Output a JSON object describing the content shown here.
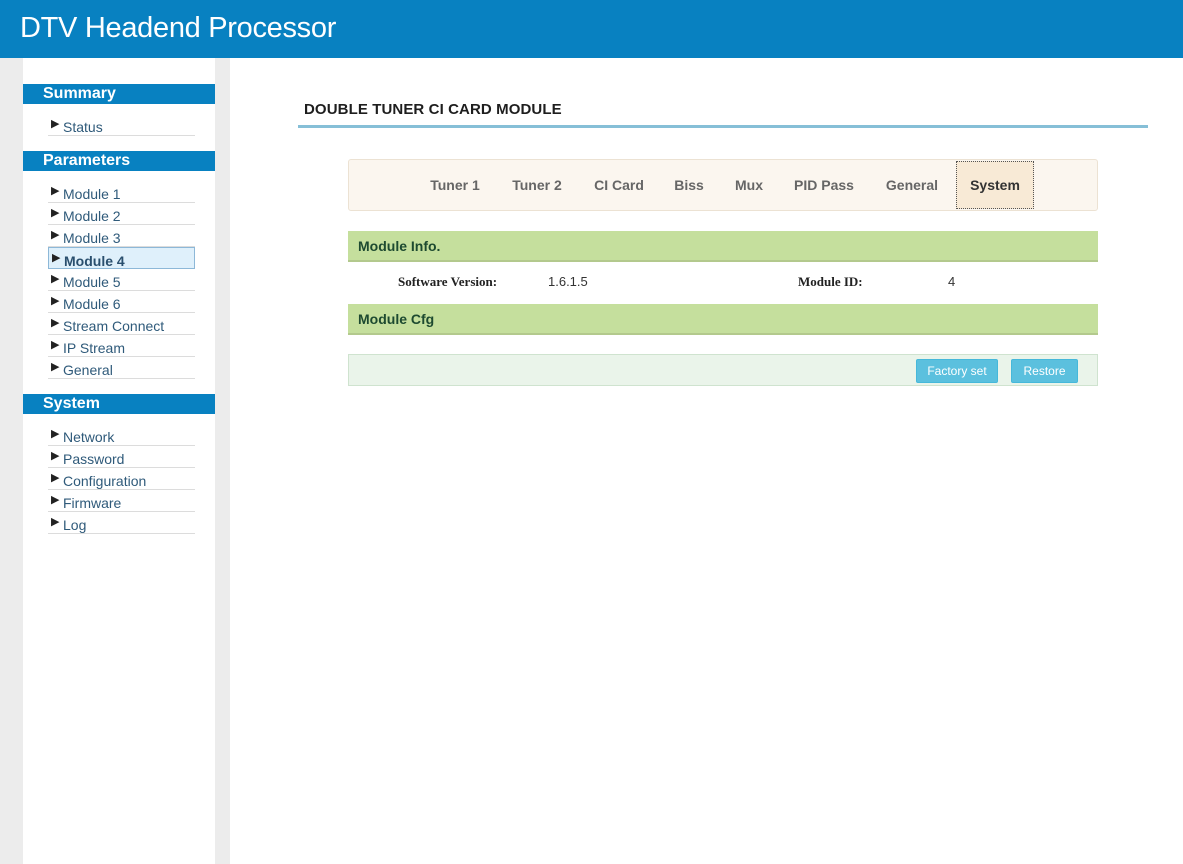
{
  "app": {
    "title": "DTV Headend Processor"
  },
  "sidebar": {
    "sections": [
      {
        "heading": "Summary",
        "items": [
          {
            "label": "Status"
          }
        ]
      },
      {
        "heading": "Parameters",
        "items": [
          {
            "label": "Module 1"
          },
          {
            "label": "Module 2"
          },
          {
            "label": "Module 3"
          },
          {
            "label": "Module 4",
            "active": true
          },
          {
            "label": "Module 5"
          },
          {
            "label": "Module 6"
          },
          {
            "label": "Stream Connect"
          },
          {
            "label": "IP Stream"
          },
          {
            "label": "General"
          }
        ]
      },
      {
        "heading": "System",
        "items": [
          {
            "label": "Network"
          },
          {
            "label": "Password"
          },
          {
            "label": "Configuration"
          },
          {
            "label": "Firmware"
          },
          {
            "label": "Log"
          }
        ]
      }
    ]
  },
  "main": {
    "page_title": "DOUBLE TUNER CI CARD MODULE",
    "tabs": [
      {
        "label": "Tuner 1"
      },
      {
        "label": "Tuner 2"
      },
      {
        "label": "CI Card"
      },
      {
        "label": "Biss"
      },
      {
        "label": "Mux"
      },
      {
        "label": "PID Pass"
      },
      {
        "label": "General"
      },
      {
        "label": "System",
        "active": true
      }
    ],
    "module_info": {
      "heading": "Module Info.",
      "software_version_label": "Software Version:",
      "software_version": "1.6.1.5",
      "module_id_label": "Module ID:",
      "module_id": "4"
    },
    "module_cfg": {
      "heading": "Module Cfg"
    },
    "actions": {
      "factory_set": "Factory set",
      "restore": "Restore"
    }
  },
  "colors": {
    "header": "#0881c1",
    "section_bar": "#c5df9d",
    "button": "#5bc0de"
  }
}
